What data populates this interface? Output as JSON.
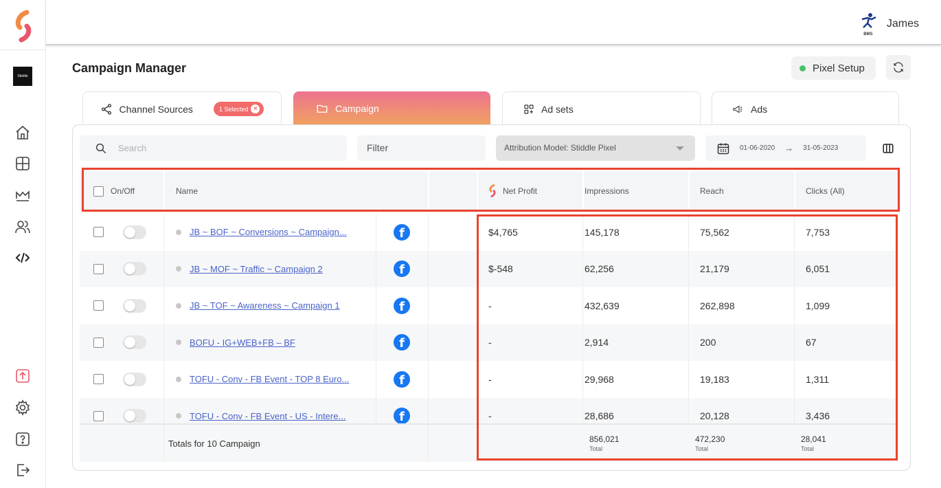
{
  "workspace": {
    "label": "Stiddle"
  },
  "user": {
    "name": "James",
    "avatar_label": "BMS"
  },
  "page": {
    "title": "Campaign Manager"
  },
  "pixel_setup": {
    "label": "Pixel Setup",
    "status_color": "#4cbf6b"
  },
  "tabs": [
    {
      "label": "Channel Sources",
      "badge": "1 Selected",
      "icon": "share-icon"
    },
    {
      "label": "Campaign",
      "icon": "folder-icon",
      "active": true
    },
    {
      "label": "Ad sets",
      "icon": "grid-add-icon"
    },
    {
      "label": "Ads",
      "icon": "megaphone-icon"
    }
  ],
  "toolbar": {
    "search_placeholder": "Search",
    "filter_label": "Filter",
    "attribution_label": "Attribution Model: Stiddle Pixel",
    "date_from": "01-06-2020",
    "date_arrow": "→",
    "date_to": "31-05-2023"
  },
  "table": {
    "headers": {
      "onoff": "On/Off",
      "name": "Name",
      "net_profit": "Net Profit",
      "impressions": "Impressions",
      "reach": "Reach",
      "clicks": "Clicks (All)"
    },
    "rows": [
      {
        "name": "JB ~ BOF ~ Conversions ~ Campaign...",
        "net_profit": "$4,765",
        "impressions": "145,178",
        "reach": "75,562",
        "clicks": "7,753"
      },
      {
        "name": "JB ~ MOF ~ Traffic ~ Campaign 2",
        "net_profit": "$-548",
        "impressions": "62,256",
        "reach": "21,179",
        "clicks": "6,051"
      },
      {
        "name": "JB ~ TOF ~ Awareness ~ Campaign 1",
        "net_profit": "-",
        "impressions": "432,639",
        "reach": "262,898",
        "clicks": "1,099"
      },
      {
        "name": "BOFU - IG+WEB+FB – BF",
        "net_profit": "-",
        "impressions": "2,914",
        "reach": "200",
        "clicks": "67"
      },
      {
        "name": "TOFU - Conv - FB Event - TOP 8 Euro...",
        "net_profit": "-",
        "impressions": "29,968",
        "reach": "19,183",
        "clicks": "1,311"
      },
      {
        "name": "TOFU - Conv - FB Event - US - Intere...",
        "net_profit": "-",
        "impressions": "28,686",
        "reach": "20,128",
        "clicks": "3,436"
      }
    ],
    "totals": {
      "label": "Totals for 10 Campaign",
      "impressions": "856,021",
      "reach": "472,230",
      "clicks": "28,041",
      "suffix": "Total"
    }
  },
  "colors": {
    "accent": "#f26b6b",
    "highlight": "#e8432e",
    "link": "#4a63c9",
    "facebook": "#1877f2"
  }
}
